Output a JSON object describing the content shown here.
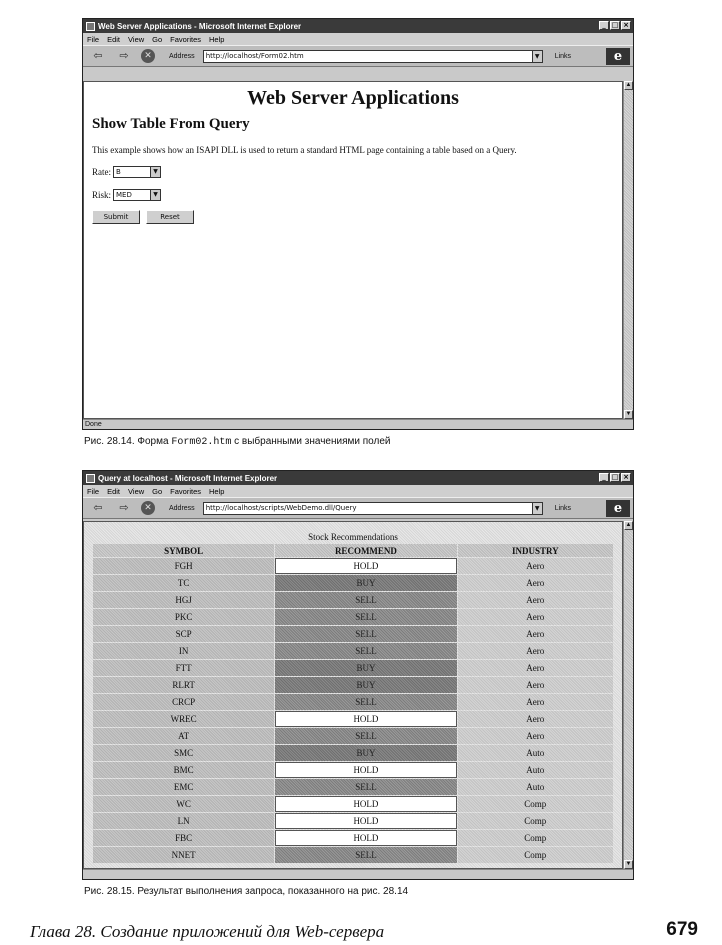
{
  "window1": {
    "title": "Web Server Applications - Microsoft Internet Explorer",
    "menu": [
      "File",
      "Edit",
      "View",
      "Go",
      "Favorites",
      "Help"
    ],
    "address_label": "Address",
    "address": "http://localhost/Form02.htm",
    "links_label": "Links",
    "heading": "Web Server Applications",
    "subheading": "Show Table From Query",
    "description": "This example shows how an ISAPI DLL is used to return a standard HTML page containing a table based on a Query.",
    "rate_label": "Rate:",
    "rate_value": "B",
    "risk_label": "Risk:",
    "risk_value": "MED",
    "submit_label": "Submit",
    "reset_label": "Reset",
    "status": "Done"
  },
  "figure1_caption": {
    "prefix": "Рис. 28.14. Форма ",
    "code": "Form02.htm",
    "suffix": " с выбранными значениями полей"
  },
  "window2": {
    "title": "Query at localhost - Microsoft Internet Explorer",
    "menu": [
      "File",
      "Edit",
      "View",
      "Go",
      "Favorites",
      "Help"
    ],
    "address_label": "Address",
    "address": "http://localhost/scripts/WebDemo.dll/Query",
    "links_label": "Links",
    "table_caption": "Stock Recommendations",
    "columns": [
      "SYMBOL",
      "RECOMMEND",
      "INDUSTRY"
    ],
    "rows": [
      {
        "symbol": "FGH",
        "recommend": "HOLD",
        "industry": "Aero"
      },
      {
        "symbol": "TC",
        "recommend": "BUY",
        "industry": "Aero"
      },
      {
        "symbol": "HGJ",
        "recommend": "SELL",
        "industry": "Aero"
      },
      {
        "symbol": "PKC",
        "recommend": "SELL",
        "industry": "Aero"
      },
      {
        "symbol": "SCP",
        "recommend": "SELL",
        "industry": "Aero"
      },
      {
        "symbol": "IN",
        "recommend": "SELL",
        "industry": "Aero"
      },
      {
        "symbol": "FTT",
        "recommend": "BUY",
        "industry": "Aero"
      },
      {
        "symbol": "RLRT",
        "recommend": "BUY",
        "industry": "Aero"
      },
      {
        "symbol": "CRCP",
        "recommend": "SELL",
        "industry": "Aero"
      },
      {
        "symbol": "WREC",
        "recommend": "HOLD",
        "industry": "Aero"
      },
      {
        "symbol": "AT",
        "recommend": "SELL",
        "industry": "Aero"
      },
      {
        "symbol": "SMC",
        "recommend": "BUY",
        "industry": "Auto"
      },
      {
        "symbol": "BMC",
        "recommend": "HOLD",
        "industry": "Auto"
      },
      {
        "symbol": "EMC",
        "recommend": "SELL",
        "industry": "Auto"
      },
      {
        "symbol": "WC",
        "recommend": "HOLD",
        "industry": "Comp"
      },
      {
        "symbol": "LN",
        "recommend": "HOLD",
        "industry": "Comp"
      },
      {
        "symbol": "FBC",
        "recommend": "HOLD",
        "industry": "Comp"
      },
      {
        "symbol": "NNET",
        "recommend": "SELL",
        "industry": "Comp"
      }
    ]
  },
  "figure2_caption": "Рис. 28.15. Результат выполнения запроса, показанного на рис. 28.14",
  "footer": "Глава 28. Создание приложений для Web-сервера",
  "page_number": "679"
}
